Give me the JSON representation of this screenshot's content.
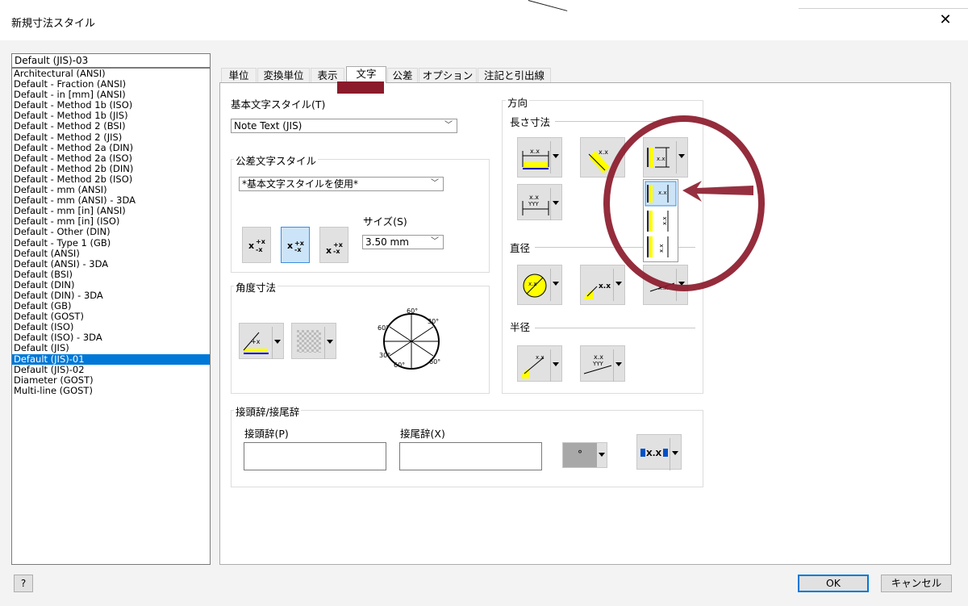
{
  "window": {
    "title": "新規寸法スタイル",
    "close_icon": "close-icon"
  },
  "style_name": "Default (JIS)-03",
  "style_list": [
    "Architectural (ANSI)",
    "Default - Fraction (ANSI)",
    "Default - in [mm] (ANSI)",
    "Default - Method 1b (ISO)",
    "Default - Method 1b (JIS)",
    "Default - Method 2 (BSI)",
    "Default - Method 2 (JIS)",
    "Default - Method 2a (DIN)",
    "Default - Method 2a (ISO)",
    "Default - Method 2b (DIN)",
    "Default - Method 2b (ISO)",
    "Default - mm (ANSI)",
    "Default - mm (ANSI) - 3DA",
    "Default - mm [in] (ANSI)",
    "Default - mm [in] (ISO)",
    "Default - Other (DIN)",
    "Default - Type 1 (GB)",
    "Default (ANSI)",
    "Default (ANSI) - 3DA",
    "Default (BSI)",
    "Default (DIN)",
    "Default (DIN) - 3DA",
    "Default (GB)",
    "Default (GOST)",
    "Default (ISO)",
    "Default (ISO) - 3DA",
    "Default (JIS)",
    "Default (JIS)-01",
    "Default (JIS)-02",
    "Diameter (GOST)",
    "Multi-line (GOST)"
  ],
  "selected_index": 27,
  "tabs": [
    "単位",
    "変換単位",
    "表示",
    "文字",
    "公差",
    "オプション",
    "注記と引出線"
  ],
  "active_tab": 3,
  "text": {
    "base_style_label": "基本文字スタイル(T)",
    "base_style_value": "Note Text (JIS)",
    "tol_group_label": "公差文字スタイル",
    "tol_style_value": "*基本文字スタイルを使用*",
    "size_label": "サイズ(S)",
    "size_value": "3.50 mm",
    "stack_glyph": "x",
    "stack_glyph_small": "+x",
    "angle_group_label": "角度寸法",
    "dial_labels": [
      "60°",
      "30°",
      "60°",
      "30°",
      "60°",
      "60°"
    ]
  },
  "direction": {
    "group_label": "方向",
    "linear_label": "長さ寸法",
    "diameter_label": "直径",
    "radius_label": "半径",
    "xx": "x.x",
    "xx_up": "X.X",
    "yyy": "YYY"
  },
  "prefix": {
    "group_label": "接頭辞/接尾辞",
    "prefix_label": "接頭辞(P)",
    "suffix_label": "接尾辞(X)",
    "prefix_value": "",
    "suffix_value": "",
    "symbol_value": "°"
  },
  "footer": {
    "ok": "OK",
    "cancel": "キャンセル",
    "help": "?"
  },
  "colors": {
    "selection": "#0078d7",
    "annotation": "#8b1a2b",
    "icon_yellow": "#ffff00",
    "icon_blue": "#0000c8"
  }
}
